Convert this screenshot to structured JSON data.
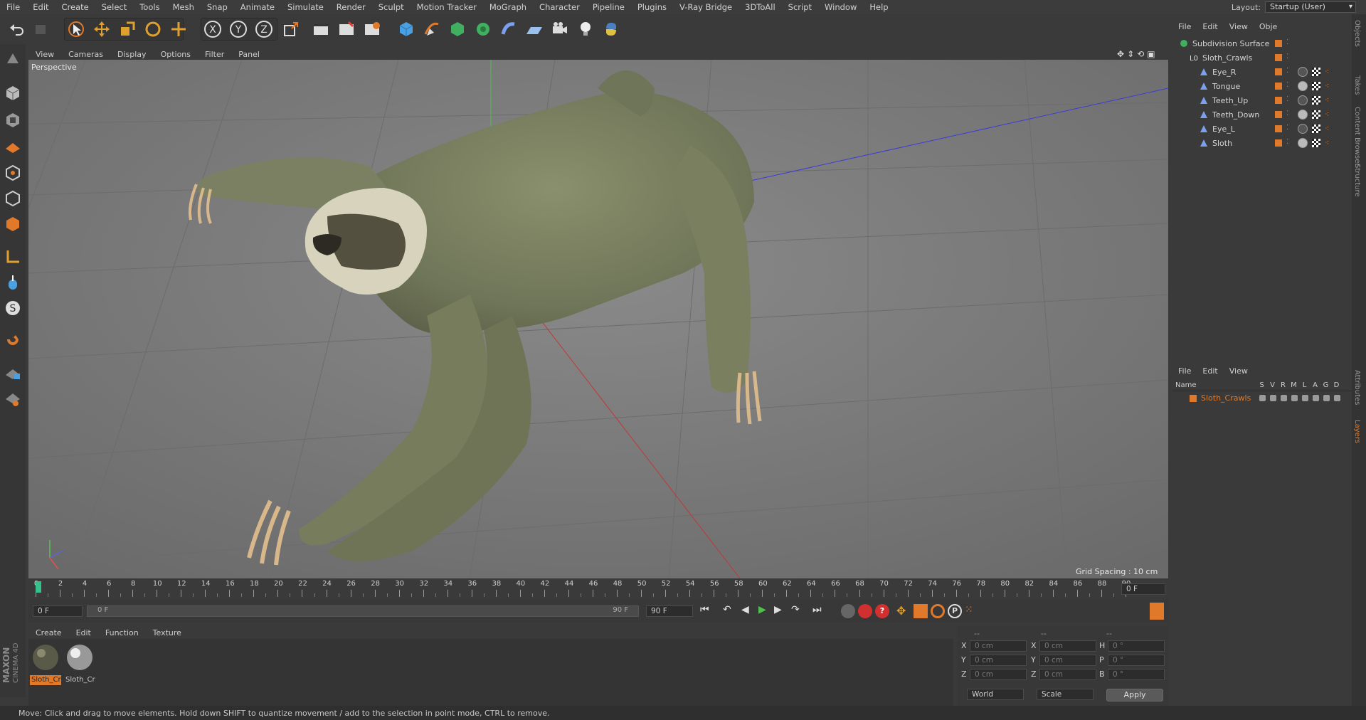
{
  "menubar": {
    "items": [
      "File",
      "Edit",
      "Create",
      "Select",
      "Tools",
      "Mesh",
      "Snap",
      "Animate",
      "Simulate",
      "Render",
      "Sculpt",
      "Motion Tracker",
      "MoGraph",
      "Character",
      "Pipeline",
      "Plugins",
      "V-Ray Bridge",
      "3DToAll",
      "Script",
      "Window",
      "Help"
    ],
    "layout_label": "Layout:",
    "layout_value": "Startup (User)"
  },
  "viewport": {
    "menu": [
      "View",
      "Cameras",
      "Display",
      "Options",
      "Filter",
      "Panel"
    ],
    "label": "Perspective",
    "grid_spacing": "Grid Spacing : 10 cm"
  },
  "timeline": {
    "ticks": [
      "0",
      "2",
      "4",
      "6",
      "8",
      "10",
      "12",
      "14",
      "16",
      "18",
      "20",
      "22",
      "24",
      "26",
      "28",
      "30",
      "32",
      "34",
      "36",
      "38",
      "40",
      "42",
      "44",
      "46",
      "48",
      "50",
      "52",
      "54",
      "56",
      "58",
      "60",
      "62",
      "64",
      "66",
      "68",
      "70",
      "72",
      "74",
      "76",
      "78",
      "80",
      "82",
      "84",
      "86",
      "88",
      "90"
    ],
    "current_frame": "0 F",
    "start_field": "0 F",
    "range_start": "0 F",
    "range_end": "90 F",
    "end_field": "90 F"
  },
  "material_manager": {
    "menu": [
      "Create",
      "Edit",
      "Function",
      "Texture"
    ],
    "materials": [
      {
        "name": "Sloth_Cr",
        "selected": true
      },
      {
        "name": "Sloth_Cr",
        "selected": false
      }
    ]
  },
  "coords": {
    "header": [
      "--",
      "--",
      "--"
    ],
    "rows": [
      {
        "a_label": "X",
        "a_val": "0 cm",
        "b_label": "X",
        "b_val": "0 cm",
        "c_label": "H",
        "c_val": "0 °"
      },
      {
        "a_label": "Y",
        "a_val": "0 cm",
        "b_label": "Y",
        "b_val": "0 cm",
        "c_label": "P",
        "c_val": "0 °"
      },
      {
        "a_label": "Z",
        "a_val": "0 cm",
        "b_label": "Z",
        "b_val": "0 cm",
        "c_label": "B",
        "c_val": "0 °"
      }
    ],
    "mode1": "World",
    "mode2": "Scale",
    "apply": "Apply"
  },
  "object_manager": {
    "menu": [
      "File",
      "Edit",
      "View",
      "Obje"
    ],
    "objects": [
      {
        "name": "Subdivision Surface",
        "indent": 0,
        "type": "subdiv"
      },
      {
        "name": "Sloth_Crawls",
        "indent": 1,
        "type": "null"
      },
      {
        "name": "Eye_R",
        "indent": 2,
        "type": "bone"
      },
      {
        "name": "Tongue",
        "indent": 2,
        "type": "bone"
      },
      {
        "name": "Teeth_Up",
        "indent": 2,
        "type": "bone"
      },
      {
        "name": "Teeth_Down",
        "indent": 2,
        "type": "bone"
      },
      {
        "name": "Eye_L",
        "indent": 2,
        "type": "bone"
      },
      {
        "name": "Sloth",
        "indent": 2,
        "type": "bone"
      }
    ]
  },
  "layer_manager": {
    "menu": [
      "File",
      "Edit",
      "View"
    ],
    "columns": [
      "Name",
      "S",
      "V",
      "R",
      "M",
      "L",
      "A",
      "G",
      "D"
    ],
    "layers": [
      {
        "name": "Sloth_Crawls",
        "color": "#e07a2a"
      }
    ]
  },
  "right_tabs": [
    "Objects",
    "Takes",
    "Content Browser",
    "Structure",
    "Attributes",
    "Layers"
  ],
  "status": "Move: Click and drag to move elements. Hold down SHIFT to quantize movement / add to the selection in point mode, CTRL to remove.",
  "brand": {
    "line1": "MAXON",
    "line2": "CINEMA 4D"
  },
  "colors": {
    "accent_orange": "#e07a2a",
    "viewport_bg": "#7b7b7b",
    "panel_bg": "#3a3a3a"
  }
}
